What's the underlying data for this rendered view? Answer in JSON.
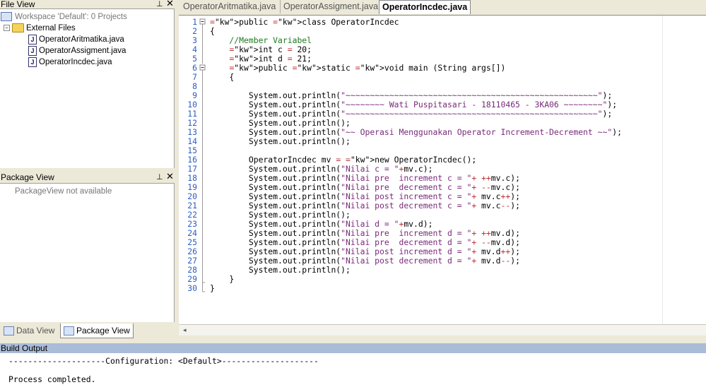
{
  "file_view": {
    "title": "File View",
    "workspace": "Workspace 'Default': 0 Projects",
    "folder": "External Files",
    "files": [
      "OperatorAritmatika.java",
      "OperatorAssigment.java",
      "OperatorIncdec.java"
    ]
  },
  "package_view": {
    "title": "Package View",
    "empty_text": "PackageView not available"
  },
  "bottom_tabs": [
    "Data View",
    "Package View"
  ],
  "editor": {
    "tabs": [
      "OperatorAritmatika.java",
      "OperatorAssigment.java",
      "OperatorIncdec.java"
    ],
    "active_tab": "OperatorIncdec.java",
    "line_numbers": [
      "1",
      "2",
      "3",
      "4",
      "5",
      "6",
      "7",
      "8",
      "9",
      "10",
      "11",
      "12",
      "13",
      "14",
      "15",
      "16",
      "17",
      "18",
      "19",
      "20",
      "21",
      "22",
      "23",
      "24",
      "25",
      "26",
      "27",
      "28",
      "29",
      "30"
    ],
    "lines": [
      "public class OperatorIncdec",
      "{",
      "    //Member Variabel",
      "    int c = 20;",
      "    int d = 21;",
      "    public static void main (String args[])",
      "    {",
      "",
      "        System.out.println(\"~~~~~~~~~~~~~~~~~~~~~~~~~~~~~~~~~~~~~~~~~~~~~~~~~~~~\");",
      "        System.out.println(\"~~~~~~~~ Wati Puspitasari - 18110465 - 3KA06 ~~~~~~~~\");",
      "        System.out.println(\"~~~~~~~~~~~~~~~~~~~~~~~~~~~~~~~~~~~~~~~~~~~~~~~~~~~~\");",
      "        System.out.println();",
      "        System.out.println(\"~~ Operasi Menggunakan Operator Increment-Decrement ~~\");",
      "        System.out.println();",
      "",
      "        OperatorIncdec mv = new OperatorIncdec();",
      "        System.out.println(\"Nilai c = \"+mv.c);",
      "        System.out.println(\"Nilai pre  increment c = \"+ ++mv.c);",
      "        System.out.println(\"Nilai pre  decrement c = \"+ --mv.c);",
      "        System.out.println(\"Nilai post increment c = \"+ mv.c++);",
      "        System.out.println(\"Nilai post decrement c = \"+ mv.c--);",
      "        System.out.println();",
      "        System.out.println(\"Nilai d = \"+mv.d);",
      "        System.out.println(\"Nilai pre  increment d = \"+ ++mv.d);",
      "        System.out.println(\"Nilai pre  decrement d = \"+ --mv.d);",
      "        System.out.println(\"Nilai post increment d = \"+ mv.d++);",
      "        System.out.println(\"Nilai post decrement d = \"+ mv.d--);",
      "        System.out.println();",
      "    }",
      "}"
    ]
  },
  "build_output": {
    "title": "Build Output",
    "lines": [
      "--------------------Configuration: <Default>--------------------",
      "",
      "Process completed."
    ]
  }
}
